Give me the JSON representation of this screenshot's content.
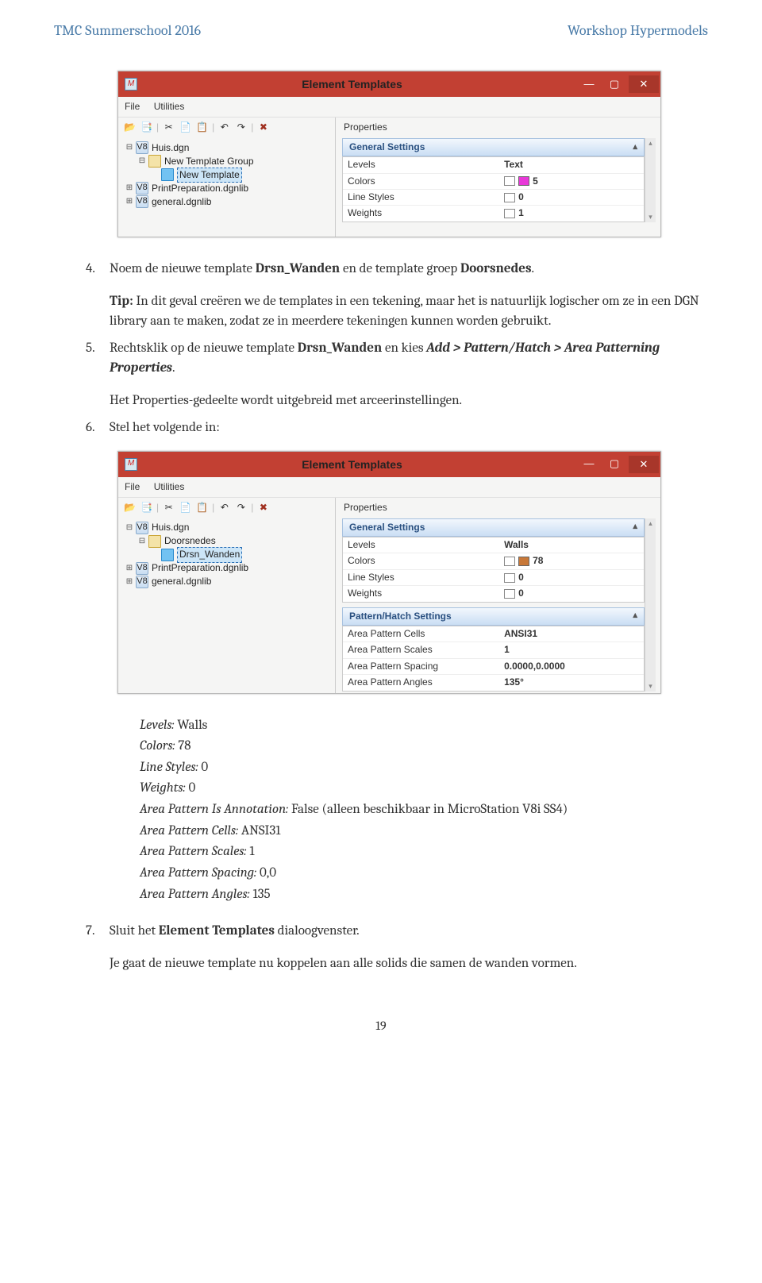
{
  "header": {
    "left": "TMC Summerschool 2016",
    "right": "Workshop Hypermodels"
  },
  "dialog1": {
    "title": "Element Templates",
    "menu": {
      "file": "File",
      "utilities": "Utilities"
    },
    "tree": {
      "n0": "Huis.dgn",
      "n1": "New Template Group",
      "n2": "New Template",
      "n3": "PrintPreparation.dgnlib",
      "n4": "general.dgnlib"
    },
    "props_label": "Properties",
    "section": "General Settings",
    "rows": {
      "r0n": "Levels",
      "r0v": "Text",
      "r1n": "Colors",
      "r1v": "5",
      "r2n": "Line Styles",
      "r2v": "0",
      "r3n": "Weights",
      "r3v": "1"
    }
  },
  "step4": {
    "num": "4.",
    "text_a": "Noem de nieuwe template ",
    "bold_a": "Drsn_Wanden",
    "text_b": " en de template groep ",
    "bold_b": "Doorsnedes",
    "text_c": "."
  },
  "tip": {
    "prefix": "Tip:",
    "text": " In dit geval creëren we de templates in een tekening, maar het is natuurlijk logischer om ze in een DGN library aan te maken, zodat ze in meerdere tekeningen kunnen worden gebruikt."
  },
  "step5": {
    "num": "5.",
    "text_a": "Rechtsklik op de nieuwe template ",
    "bold_a": "Drsn_Wanden",
    "text_b": " en kies ",
    "bi_a": "Add > Pattern/Hatch > Area Patterning Properties",
    "text_c": "."
  },
  "step5_post": "Het Properties-gedeelte wordt uitgebreid met arceerinstellingen.",
  "step6": {
    "num": "6.",
    "text": "Stel het volgende in:"
  },
  "dialog2": {
    "title": "Element Templates",
    "menu": {
      "file": "File",
      "utilities": "Utilities"
    },
    "tree": {
      "n0": "Huis.dgn",
      "n1": "Doorsnedes",
      "n2": "Drsn_Wanden",
      "n3": "PrintPreparation.dgnlib",
      "n4": "general.dgnlib"
    },
    "props_label": "Properties",
    "sectionA": "General Settings",
    "rowsA": {
      "r0n": "Levels",
      "r0v": "Walls",
      "r1n": "Colors",
      "r1v": "78",
      "r2n": "Line Styles",
      "r2v": "0",
      "r3n": "Weights",
      "r3v": "0"
    },
    "sectionB": "Pattern/Hatch Settings",
    "rowsB": {
      "r0n": "Area Pattern Cells",
      "r0v": "ANSI31",
      "r1n": "Area Pattern Scales",
      "r1v": "1",
      "r2n": "Area Pattern Spacing",
      "r2v": "0.0000,0.0000",
      "r3n": "Area Pattern Angles",
      "r3v": "135°"
    }
  },
  "settings": {
    "l0_a": "Levels:",
    "l0_b": " Walls",
    "l1_a": "Colors:",
    "l1_b": " 78",
    "l2_a": "Line Styles:",
    "l2_b": " 0",
    "l3_a": "Weights:",
    "l3_b": " 0",
    "l4_a": "Area Pattern Is Annotation:",
    "l4_b": " False  (alleen beschikbaar in MicroStation V8i SS4)",
    "l5_a": "Area Pattern Cells:",
    "l5_b": " ANSI31",
    "l6_a": "Area Pattern Scales:",
    "l6_b": " 1",
    "l7_a": "Area Pattern Spacing:",
    "l7_b": " 0,0",
    "l8_a": "Area Pattern Angles:",
    "l8_b": " 135"
  },
  "step7": {
    "num": "7.",
    "text_a": "Sluit het ",
    "bold_a": "Element Templates",
    "text_b": " dialoogvenster."
  },
  "step7_post": "Je gaat de nieuwe template nu koppelen aan alle solids die samen de wanden vormen.",
  "page_number": "19"
}
